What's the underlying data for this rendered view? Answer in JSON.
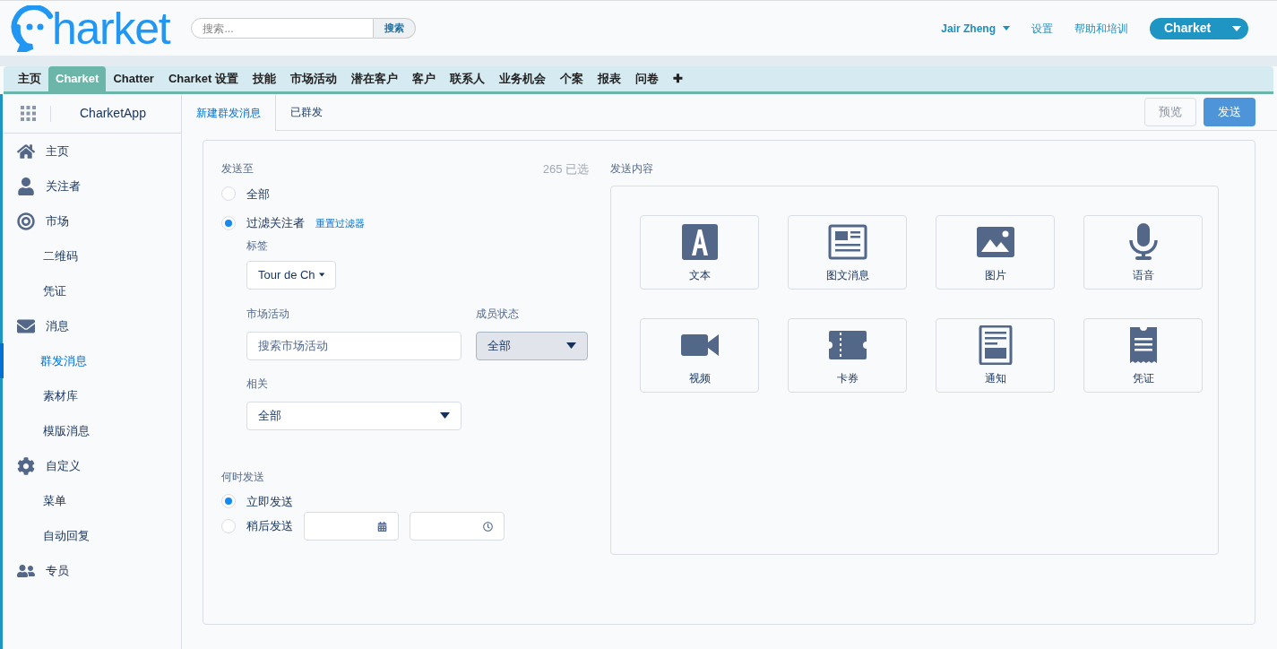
{
  "header": {
    "logo": "harket",
    "search": {
      "placeholder": "搜索...",
      "button": "搜索"
    },
    "user": "Jair Zheng",
    "links": [
      "设置",
      "帮助和培训"
    ],
    "app_button": "Charket"
  },
  "nav_tabs": [
    {
      "label": "主页",
      "selected": false
    },
    {
      "label": "Charket",
      "selected": true
    },
    {
      "label": "Chatter",
      "selected": false
    },
    {
      "label": "Charket 设置",
      "selected": false
    },
    {
      "label": "技能",
      "selected": false
    },
    {
      "label": "市场活动",
      "selected": false
    },
    {
      "label": "潜在客户",
      "selected": false
    },
    {
      "label": "客户",
      "selected": false
    },
    {
      "label": "联系人",
      "selected": false
    },
    {
      "label": "业务机会",
      "selected": false
    },
    {
      "label": "个案",
      "selected": false
    },
    {
      "label": "报表",
      "selected": false
    },
    {
      "label": "问卷",
      "selected": false
    },
    {
      "label": "✚",
      "selected": false
    }
  ],
  "sidebar": {
    "app_name": "CharketApp",
    "items": [
      {
        "label": "主页",
        "kind": "home",
        "selected": false
      },
      {
        "label": "关注者",
        "kind": "user",
        "selected": false
      },
      {
        "label": "市场",
        "kind": "target",
        "selected": false,
        "children": [
          {
            "label": "二维码",
            "selected": false
          },
          {
            "label": "凭证",
            "selected": false
          }
        ]
      },
      {
        "label": "消息",
        "kind": "mail",
        "selected": false,
        "children": [
          {
            "label": "群发消息",
            "selected": true
          },
          {
            "label": "素材库",
            "selected": false
          },
          {
            "label": "模版消息",
            "selected": false
          }
        ]
      },
      {
        "label": "自定义",
        "kind": "gear",
        "selected": false,
        "children": [
          {
            "label": "菜单",
            "selected": false
          },
          {
            "label": "自动回复",
            "selected": false
          }
        ]
      },
      {
        "label": "专员",
        "kind": "agent",
        "selected": false
      }
    ]
  },
  "page_tabs": [
    {
      "label": "新建群发消息",
      "selected": true
    },
    {
      "label": "已群发",
      "selected": false
    }
  ],
  "actions": {
    "preview": {
      "label": "预览",
      "disabled": true
    },
    "send": {
      "label": "发送",
      "disabled": false
    }
  },
  "send_to": {
    "title": "发送至",
    "count": "265 已选",
    "options": [
      {
        "label": "全部",
        "selected": false
      },
      {
        "label": "过滤关注者",
        "selected": true
      }
    ],
    "reset_link": "重置过滤器",
    "tag": {
      "label": "标签",
      "value": "Tour de Ch"
    },
    "campaign": {
      "label": "市场活动",
      "placeholder": "搜索市场活动"
    },
    "member_status": {
      "label": "成员状态",
      "value": "全部"
    },
    "related": {
      "label": "相关",
      "value": "全部"
    }
  },
  "when": {
    "title": "何时发送",
    "options": [
      {
        "label": "立即发送",
        "selected": true
      },
      {
        "label": "稍后发送",
        "selected": false
      }
    ]
  },
  "content": {
    "title": "发送内容",
    "types": [
      {
        "label": "文本",
        "kind": "text"
      },
      {
        "label": "图文消息",
        "kind": "news"
      },
      {
        "label": "图片",
        "kind": "image"
      },
      {
        "label": "语音",
        "kind": "voice"
      },
      {
        "label": "视频",
        "kind": "video"
      },
      {
        "label": "卡券",
        "kind": "card"
      },
      {
        "label": "通知",
        "kind": "notice"
      },
      {
        "label": "凭证",
        "kind": "voucher"
      }
    ]
  }
}
